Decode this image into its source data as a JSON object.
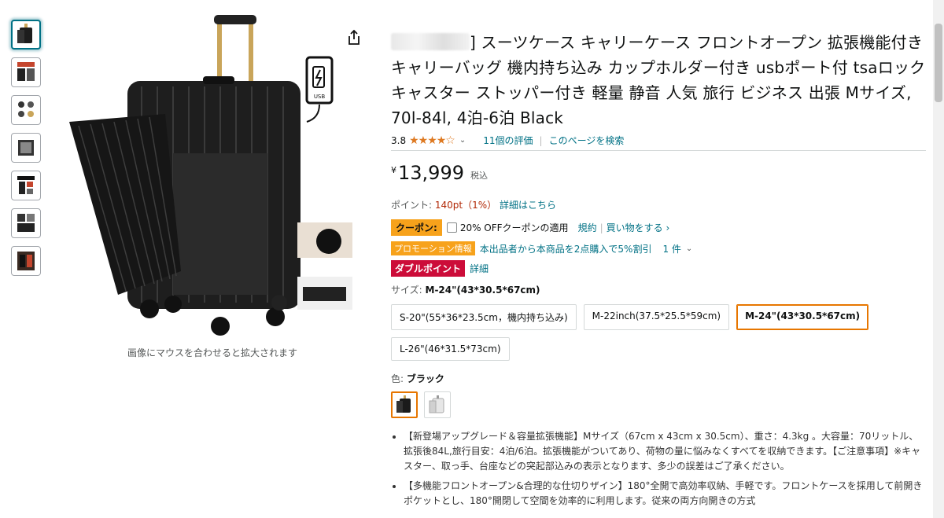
{
  "gallery": {
    "thumbnails": [
      "thumb-1",
      "thumb-2",
      "thumb-3",
      "thumb-4",
      "thumb-5",
      "thumb-6",
      "thumb-7"
    ],
    "zoom_hint": "画像にマウスを合わせると拡大されます",
    "usb_label": "USB"
  },
  "product": {
    "title_rest": "] スーツケース キャリーケース フロントオープン 拡張機能付き キャリーバッグ 機内持ち込み カップホルダー付き usbポート付 tsaロック キャスター ストッパー付き 軽量 静音 人気 旅行 ビジネス 出張 Mサイズ, 70l-84l, 4泊-6泊 Black",
    "rating": "3.8",
    "stars": "★★★★☆",
    "reviews": "11個の評価",
    "search_page": "このページを検索",
    "price_symbol": "¥",
    "price": "13,999",
    "tax": "税込"
  },
  "points": {
    "label": "ポイント: ",
    "value": "140pt（1%）",
    "link": "詳細はこちら"
  },
  "coupon": {
    "badge": "クーポン:",
    "text": "20% OFFクーポンの適用",
    "terms": "規約",
    "shop": "買い物をする ›"
  },
  "promotion": {
    "badge": "プロモーション情報",
    "text": "本出品者から本商品を2点購入で5%割引",
    "count": "1 件"
  },
  "double_point": {
    "badge": "ダブルポイント",
    "link": "詳細"
  },
  "size": {
    "label": "サイズ: ",
    "selected": "M-24\"(43*30.5*67cm)",
    "options": [
      "S-20\"(55*36*23.5cm，機内持ち込み)",
      "M-22inch(37.5*25.5*59cm)",
      "M-24\"(43*30.5*67cm)",
      "L-26\"(46*31.5*73cm)"
    ]
  },
  "color": {
    "label": "色: ",
    "selected": "ブラック"
  },
  "bullets": [
    "【新登場アップグレード＆容量拡張機能】Mサイズ（67cm x 43cm x 30.5cm）、重さ：4.3kg 。大容量：70リットル、拡張後84L,旅行目安：4泊/6泊。拡張機能がついてあり、荷物の量に悩みなくすべてを収納できます。【ご注意事項】※キャスター、取っ手、台座などの突起部込みの表示となります、多少の誤差はご了承ください。",
    "【多機能フロントオープン&合理的な仕切りザイン】180°全開で高効率収納、手軽です。フロントケースを採用して前開きポケットとし、180°開閉して空間を効率的に利用します。従来の両方向開きの方式"
  ],
  "colors": {
    "accent": "#e77600",
    "link": "#007185",
    "star": "#de7921",
    "coupon": "#f7a21b",
    "double": "#cc0c39",
    "price_red": "#b12704"
  }
}
